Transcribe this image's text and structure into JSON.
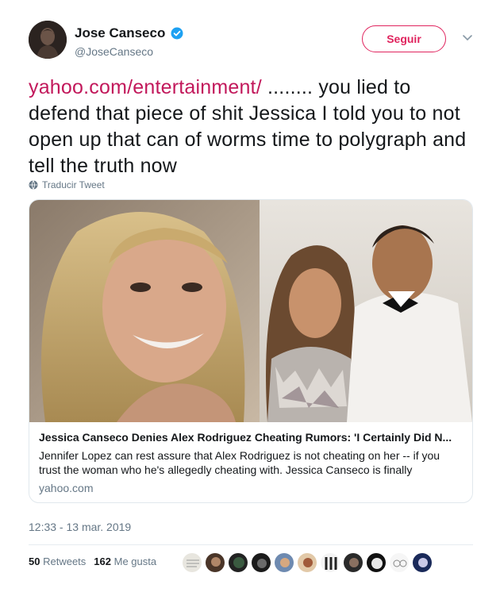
{
  "author": {
    "name": "Jose Canseco",
    "handle": "@JoseCanseco",
    "verified_icon": "verified-badge-icon",
    "follow_label": "Seguir"
  },
  "tweet": {
    "link_text": "yahoo.com/entertainment/",
    "body": " ........ you lied to defend that piece of shit Jessica I told you to not open up that can of worms time to polygraph and tell the truth now",
    "translate_label": "Traducir Tweet"
  },
  "card": {
    "title": "Jessica Canseco Denies Alex Rodriguez Cheating Rumors: 'I Certainly Did N...",
    "description": "Jennifer Lopez can rest assure that Alex Rodriguez is not cheating on her -- if you trust the woman who he's allegedly cheating with. Jessica Canseco is finally",
    "domain": "yahoo.com"
  },
  "timestamp": "12:33 - 13 mar. 2019",
  "stats": {
    "retweets_count": "50",
    "retweets_label": "Retweets",
    "likes_count": "162",
    "likes_label": "Me gusta"
  },
  "colors": {
    "accent": "#e0245e",
    "link": "#c2185b",
    "verified": "#1da1f2",
    "muted": "#657786"
  }
}
